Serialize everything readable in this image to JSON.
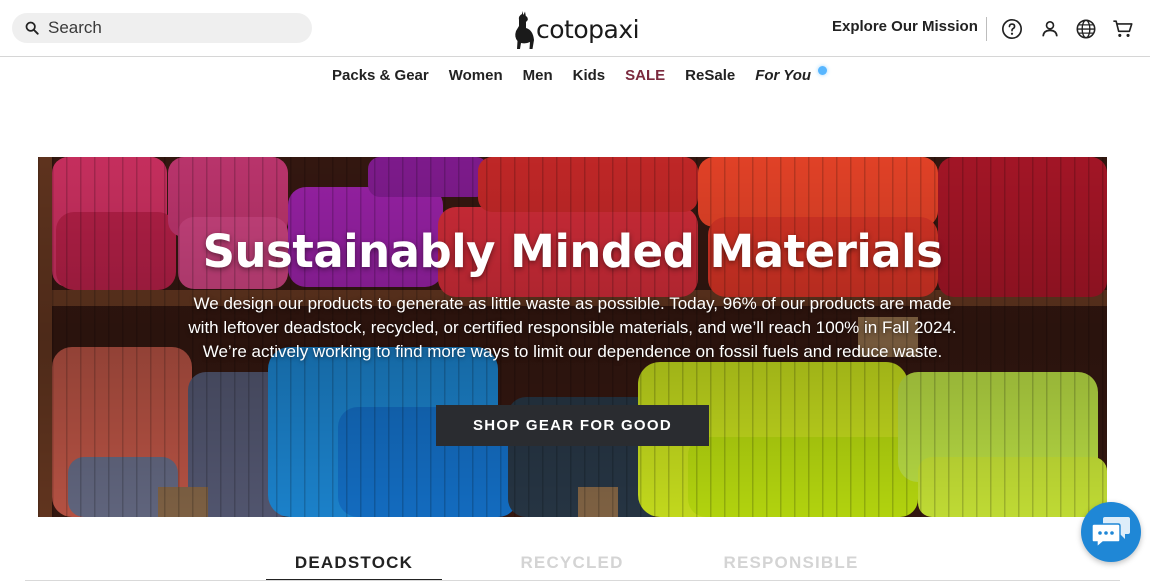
{
  "header": {
    "search": {
      "placeholder": "Search",
      "value": ""
    },
    "logo_text": "cotopaxi",
    "mission_link": "Explore Our Mission",
    "icons": [
      "help-icon",
      "account-icon",
      "globe-icon",
      "cart-icon"
    ]
  },
  "nav": {
    "items": [
      {
        "label": "Packs & Gear"
      },
      {
        "label": "Women"
      },
      {
        "label": "Men"
      },
      {
        "label": "Kids"
      },
      {
        "label": "SALE"
      },
      {
        "label": "ReSale"
      },
      {
        "label": "For You"
      }
    ]
  },
  "hero": {
    "title": "Sustainably Minded Materials",
    "description": "We design our products to generate as little waste as possible. Today, 96% of our products are made with leftover deadstock, recycled, or certified responsible materials, and we’ll reach 100% in Fall 2024. We’re actively working to find more ways to limit our dependence on fossil fuels and reduce waste.",
    "button": "SHOP GEAR FOR GOOD"
  },
  "tabs": [
    {
      "label": "DEADSTOCK",
      "active": true
    },
    {
      "label": "RECYCLED",
      "active": false
    },
    {
      "label": "RESPONSIBLE",
      "active": false
    }
  ],
  "colors": {
    "sale": "#7b2a3e",
    "notification_dot": "#57b6ff",
    "chat": "#1f87d6",
    "button": "#2a2c30"
  }
}
